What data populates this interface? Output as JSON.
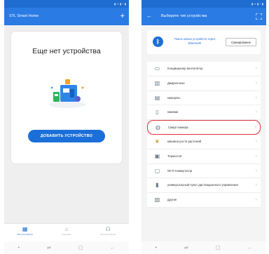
{
  "left_phone": {
    "app_title": "STL Smart Home",
    "add_icon": "plus-icon",
    "empty_title": "Еще нет устройства",
    "add_device_button": "ДОБАВИТЬ УСТРОЙСТВО",
    "tabs": [
      {
        "icon": "grid-icon",
        "label": "Мои устройства",
        "active": true
      },
      {
        "icon": "home-icon",
        "label": "Сценарии",
        "active": false
      },
      {
        "icon": "headset-icon",
        "label": "Личный кабинет",
        "active": false
      }
    ]
  },
  "right_phone": {
    "header_title": "Выберите тип устройства",
    "bluetooth": {
      "icon": "bluetooth-icon",
      "text": "Поиск новых устройств через Bluetooth",
      "button": "Сканирование"
    },
    "device_types": [
      {
        "label": "Кондиционер вентилятор",
        "icon": "air-conditioner-icon"
      },
      {
        "label": "Джиренчене",
        "icon": "fan-icon"
      },
      {
        "label": "камерать",
        "icon": "heater-icon"
      },
      {
        "label": "камами",
        "icon": "camera-icon"
      },
      {
        "label": "Смарт-камера",
        "icon": "smart-camera-icon",
        "highlighted": true
      },
      {
        "label": "машина роста растений",
        "icon": "plant-icon"
      },
      {
        "label": "Термостат",
        "icon": "thermostat-icon"
      },
      {
        "label": "Wi-Fi Коммутатор",
        "icon": "switch-icon"
      },
      {
        "label": "универсальный пульт дистанционного управления",
        "icon": "remote-icon"
      },
      {
        "label": "другие",
        "icon": "other-icon"
      }
    ]
  },
  "colors": {
    "primary": "#2a7be4",
    "statusbar": "#1f6dd1",
    "highlight": "#e0303a"
  }
}
